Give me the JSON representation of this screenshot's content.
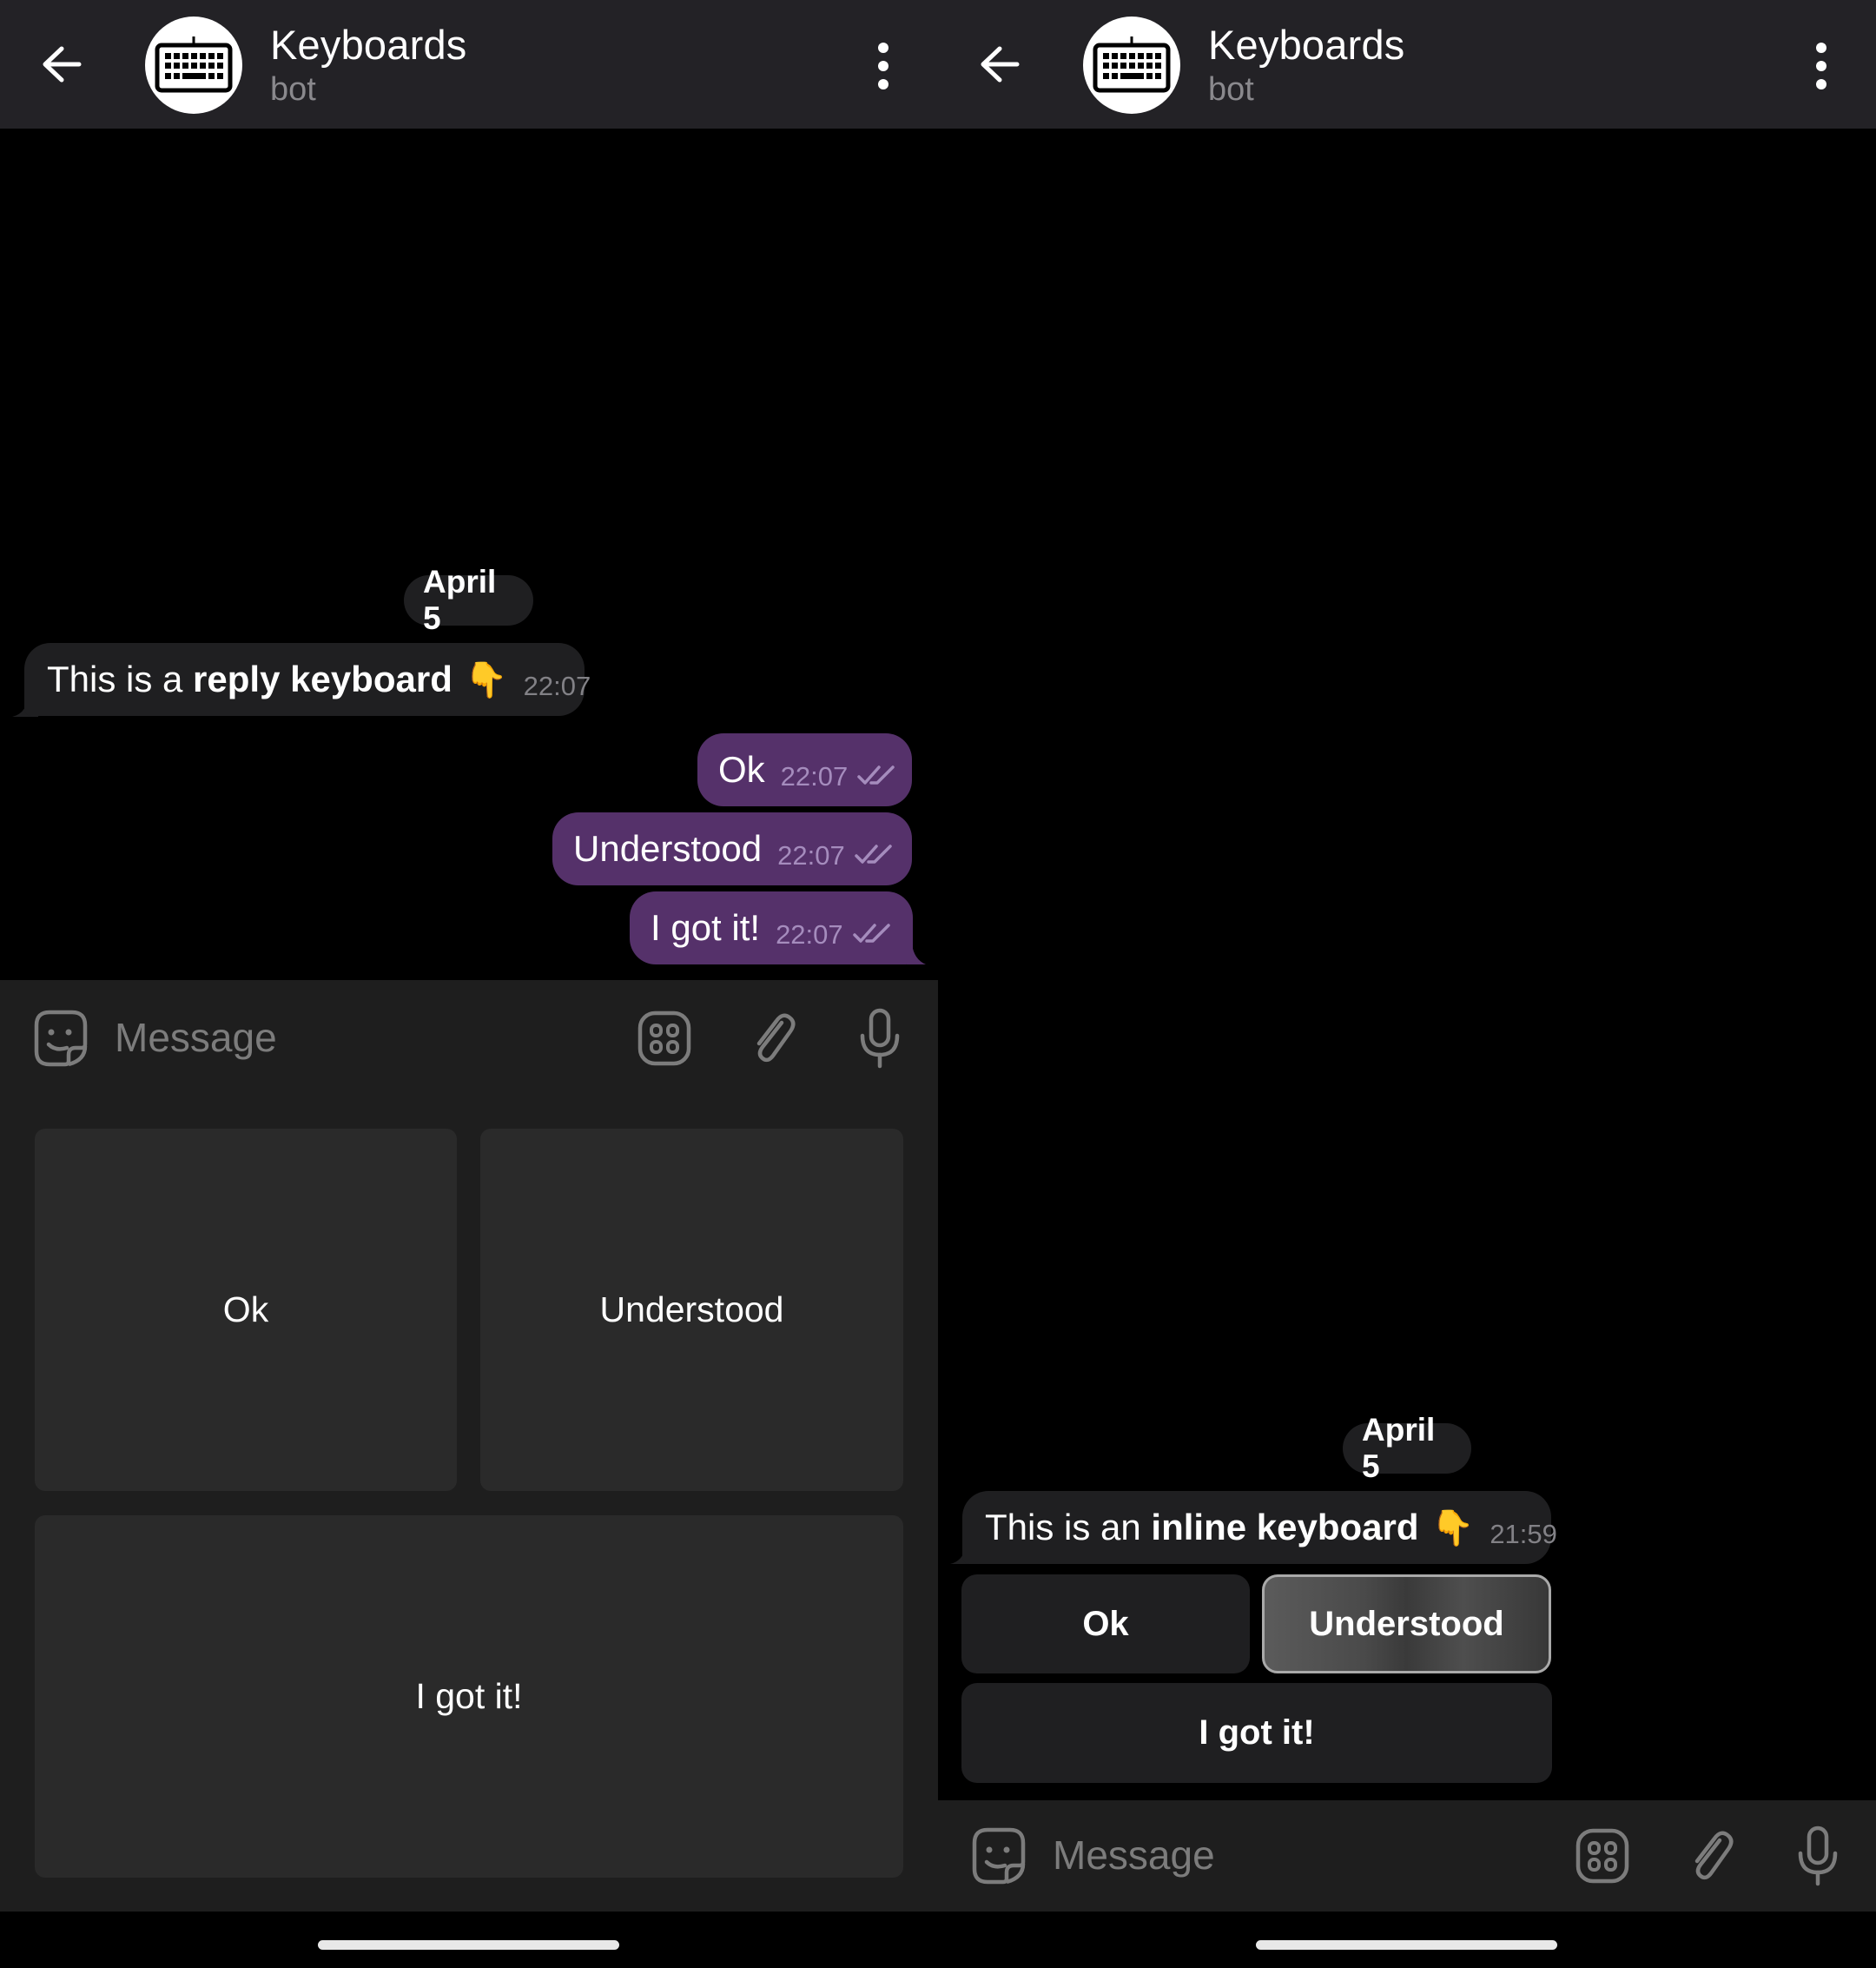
{
  "colors": {
    "header_bg": "#232226",
    "incoming_bubble": "#1f1f21",
    "outgoing_bubble": "#55316a",
    "outgoing_time": "#a58cbd",
    "compose_bg": "#1e1e1e",
    "keyboard_button": "#2a2a2a",
    "icon_gray": "#7c7c7c"
  },
  "left_panel": {
    "header": {
      "back_icon": "arrow-left",
      "avatar_icon": "keyboard",
      "title": "Keyboards",
      "subtitle": "bot",
      "menu_icon": "more-vertical"
    },
    "date_chip": "April 5",
    "incoming_message": {
      "text_prefix": "This is a ",
      "text_bold": "reply keyboard",
      "emoji": "👇",
      "time": "22:07"
    },
    "outgoing_messages": [
      {
        "text": "Ok",
        "time": "22:07",
        "status": "read"
      },
      {
        "text": "Understood",
        "time": "22:07",
        "status": "read"
      },
      {
        "text": "I got it!",
        "time": "22:07",
        "status": "read"
      }
    ],
    "composer": {
      "placeholder": "Message",
      "icons": [
        "sticker",
        "bot-keyboard",
        "attach",
        "microphone"
      ]
    },
    "reply_keyboard": {
      "rows": [
        [
          "Ok",
          "Understood"
        ],
        [
          "I got it!"
        ]
      ]
    }
  },
  "right_panel": {
    "header": {
      "back_icon": "arrow-left",
      "avatar_icon": "keyboard",
      "title": "Keyboards",
      "subtitle": "bot",
      "menu_icon": "more-vertical"
    },
    "date_chip": "April 5",
    "incoming_message": {
      "text_prefix": "This is an ",
      "text_bold": "inline keyboard",
      "emoji": "👇",
      "time": "21:59"
    },
    "inline_keyboard": {
      "rows": [
        [
          "Ok",
          "Understood"
        ],
        [
          "I got it!"
        ]
      ],
      "pressed": "Understood"
    },
    "composer": {
      "placeholder": "Message",
      "icons": [
        "sticker",
        "bot-keyboard",
        "attach",
        "microphone"
      ]
    }
  }
}
